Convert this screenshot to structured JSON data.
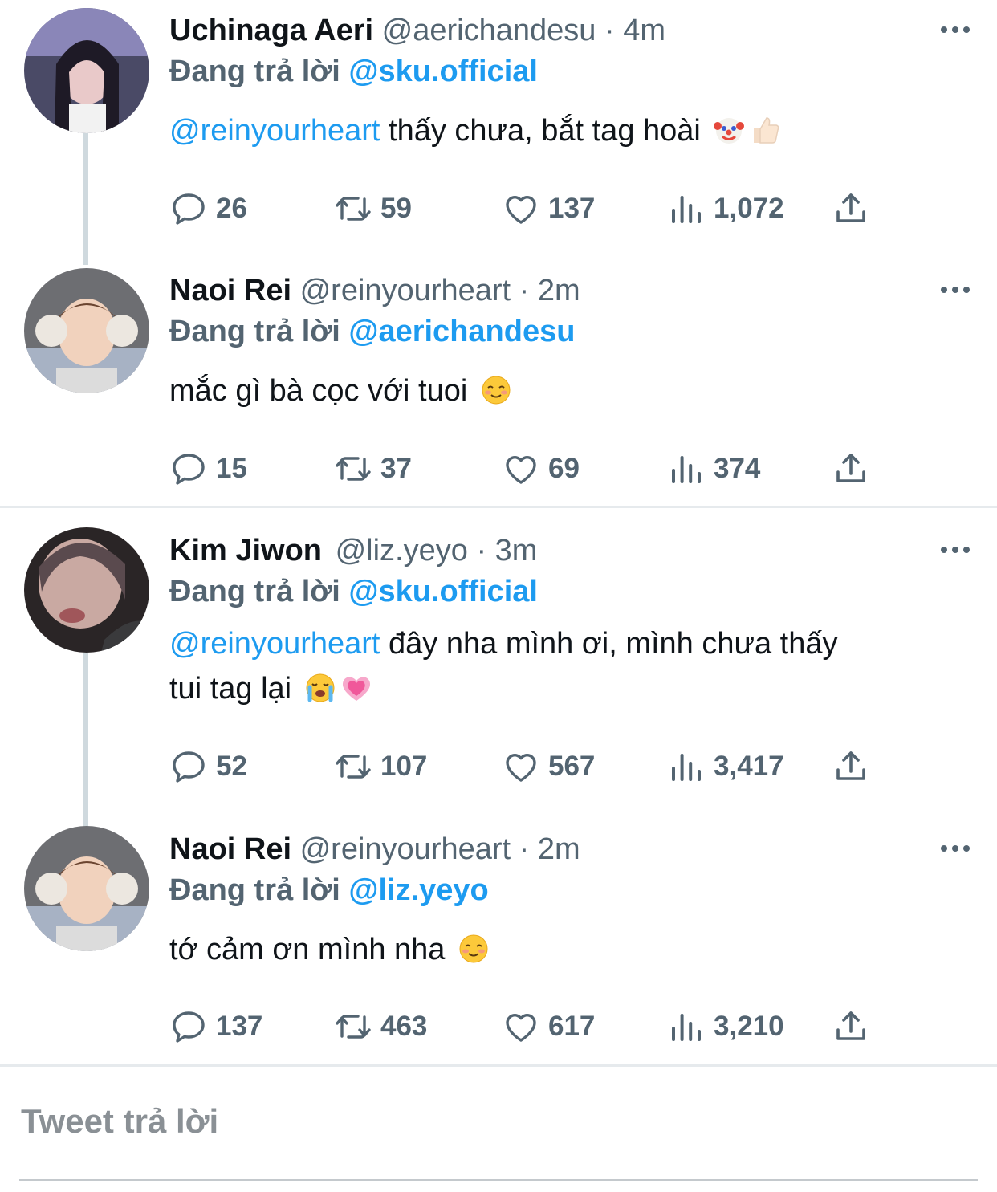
{
  "tweets": [
    {
      "name": "Uchinaga Aeri",
      "handle": "@aerichandesu",
      "time": "4m",
      "reply_prefix": "Đang trả lời",
      "reply_to": "@sku.official",
      "mention": "@reinyourheart",
      "text": " thấy chưa, bắt tag hoài",
      "text_line2": "",
      "emojis": [
        "clown-emoji",
        "thumbs-up-emoji"
      ],
      "replies": "26",
      "retweets": "59",
      "likes": "137",
      "views": "1,072"
    },
    {
      "name": "Naoi Rei",
      "handle": "@reinyourheart",
      "time": "2m",
      "reply_prefix": "Đang trả lời",
      "reply_to": "@aerichandesu",
      "mention": "",
      "text": "mắc gì bà cọc với tuoi",
      "text_line2": "",
      "emojis": [
        "smiling-blush-emoji"
      ],
      "replies": "15",
      "retweets": "37",
      "likes": "69",
      "views": "374"
    },
    {
      "name": "Kim Jiwon",
      "handle": "@liz.yeyo",
      "time": "3m",
      "reply_prefix": "Đang trả lời",
      "reply_to": "@sku.official",
      "mention": "@reinyourheart",
      "text": " đây nha mình ơi, mình chưa thấy",
      "text_line2": "tui tag lại",
      "emojis": [
        "crying-emoji",
        "growing-heart-emoji"
      ],
      "replies": "52",
      "retweets": "107",
      "likes": "567",
      "views": "3,417"
    },
    {
      "name": "Naoi Rei",
      "handle": "@reinyourheart",
      "time": "2m",
      "reply_prefix": "Đang trả lời",
      "reply_to": "@liz.yeyo",
      "mention": "",
      "text": "tớ cảm ơn mình nha",
      "text_line2": "",
      "emojis": [
        "smiling-blush-emoji"
      ],
      "replies": "137",
      "retweets": "463",
      "likes": "617",
      "views": "3,210"
    }
  ],
  "separator_dot": "·",
  "compose": {
    "placeholder": "Tweet trả lời"
  },
  "colors": {
    "link": "#1d9bf0",
    "secondary": "#536471",
    "thread_line": "#cfd9de"
  }
}
